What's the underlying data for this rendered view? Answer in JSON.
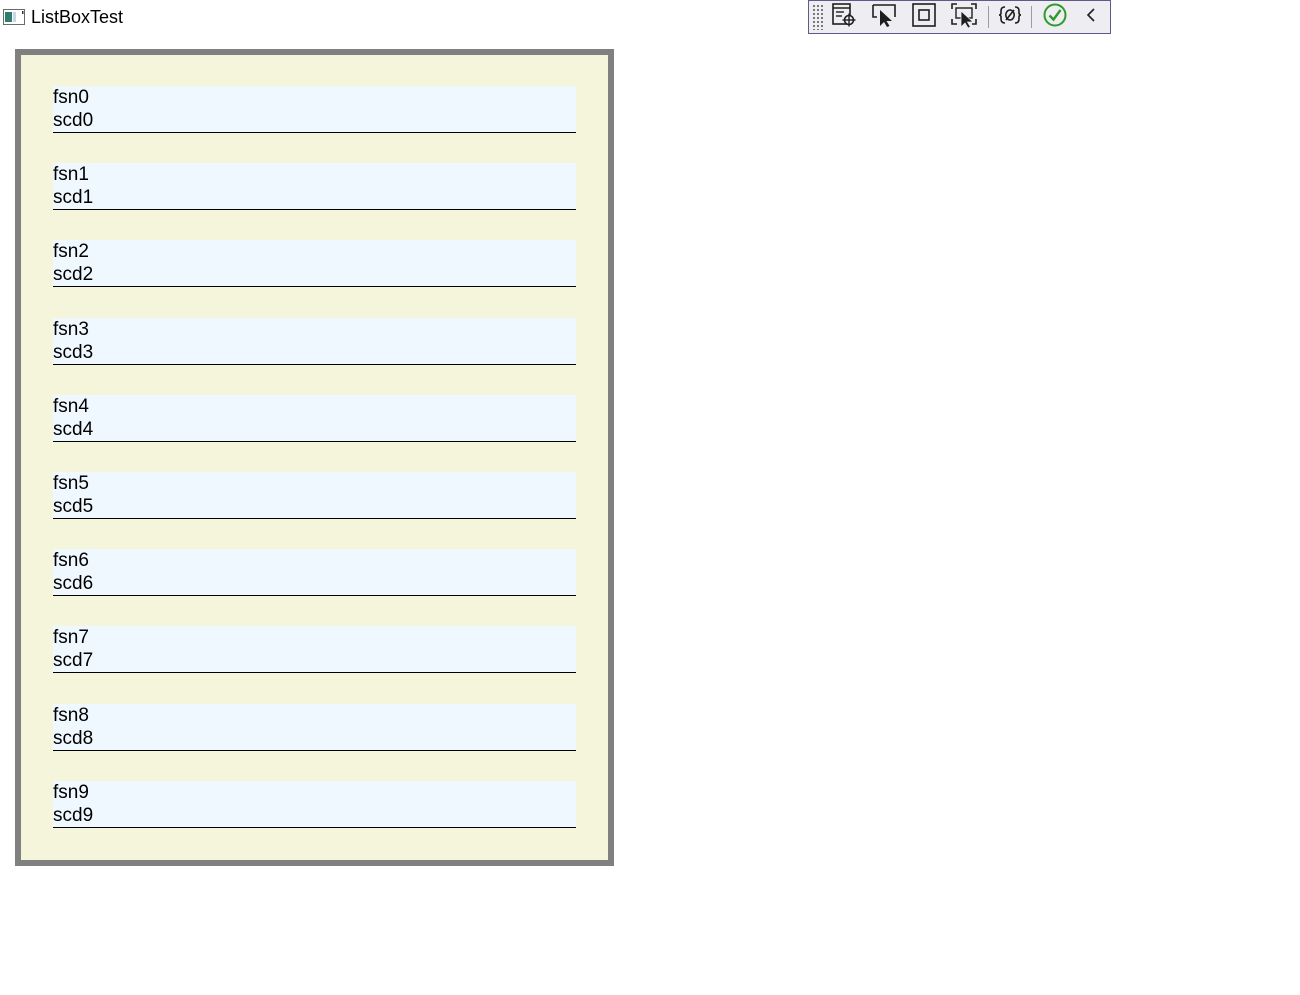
{
  "window": {
    "title": "ListBoxTest"
  },
  "toolbar": {
    "buttons": [
      {
        "name": "select-element-icon"
      },
      {
        "name": "select-pointer-icon"
      },
      {
        "name": "layout-adorners-icon"
      },
      {
        "name": "track-focus-icon"
      },
      {
        "name": "binding-failures-icon"
      },
      {
        "name": "accessibility-check-icon"
      },
      {
        "name": "collapse-chevron-icon"
      }
    ]
  },
  "listbox": {
    "items": [
      {
        "first": "fsn0",
        "second": "scd0"
      },
      {
        "first": "fsn1",
        "second": "scd1"
      },
      {
        "first": "fsn2",
        "second": "scd2"
      },
      {
        "first": "fsn3",
        "second": "scd3"
      },
      {
        "first": "fsn4",
        "second": "scd4"
      },
      {
        "first": "fsn5",
        "second": "scd5"
      },
      {
        "first": "fsn6",
        "second": "scd6"
      },
      {
        "first": "fsn7",
        "second": "scd7"
      },
      {
        "first": "fsn8",
        "second": "scd8"
      },
      {
        "first": "fsn9",
        "second": "scd9"
      }
    ]
  },
  "colors": {
    "listbox_background": "#f5f5dc",
    "listbox_border": "#808080",
    "item_background": "#f0f8ff",
    "toolbar_background": "#eeeef2",
    "toolbar_border": "#5b5b8c",
    "check_green": "#2e9a2e"
  }
}
